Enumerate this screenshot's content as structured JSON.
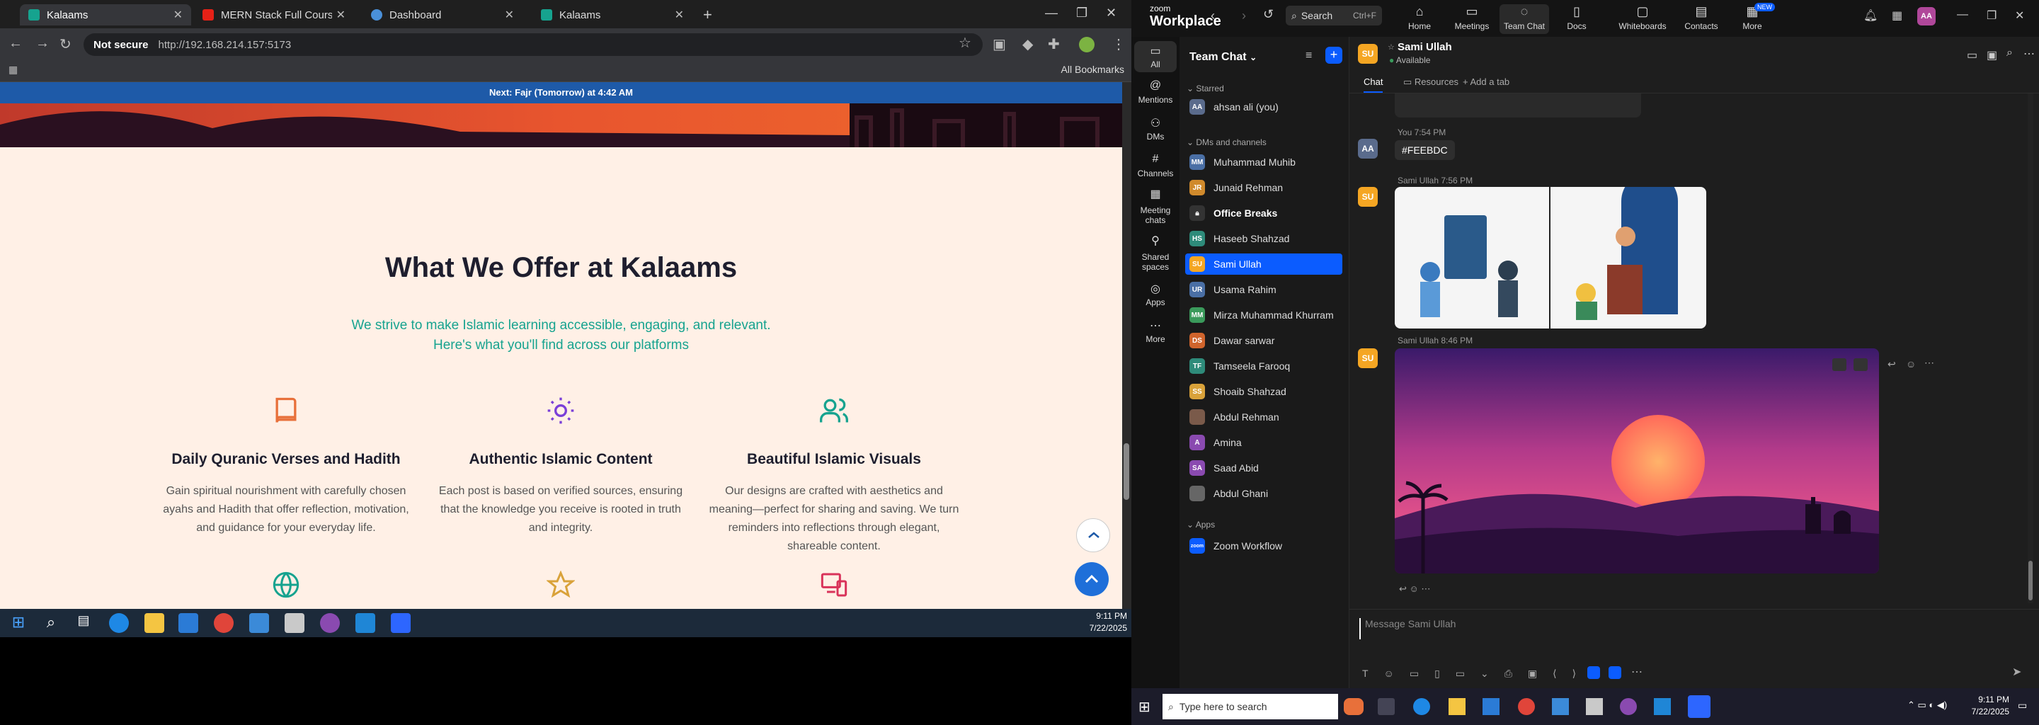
{
  "browser": {
    "tabs": [
      {
        "title": "Kalaams",
        "active": true
      },
      {
        "title": "MERN Stack Full Course - ECom",
        "active": false
      },
      {
        "title": "Dashboard",
        "active": false
      },
      {
        "title": "Kalaams",
        "active": false
      }
    ],
    "not_secure_label": "Not secure",
    "url": "http://192.168.214.157:5173",
    "all_bookmarks": "All Bookmarks"
  },
  "page": {
    "notice_prefix": "Next: ",
    "notice_prayer": "Fajr (Tomorrow)",
    "notice_suffix": " at 4:42 AM",
    "title": "What We Offer at Kalaams",
    "subtitle_line1": "We strive to make Islamic learning accessible, engaging, and relevant.",
    "subtitle_line2": "Here's what you'll find across our platforms",
    "features": [
      {
        "icon": "book-icon",
        "title": "Daily Quranic Verses and Hadith",
        "text": "Gain spiritual nourishment with carefully chosen ayahs and Hadith that offer reflection, motivation, and guidance for your everyday life."
      },
      {
        "icon": "sun-icon",
        "title": "Authentic Islamic Content",
        "text": "Each post is based on verified sources, ensuring that the knowledge you receive is rooted in truth and integrity."
      },
      {
        "icon": "users-icon",
        "title": "Beautiful Islamic Visuals",
        "text": "Our designs are crafted with aesthetics and meaning—perfect for sharing and saving. We turn reminders into reflections through elegant, shareable content."
      }
    ],
    "next_icons": [
      "globe-icon",
      "star-icon",
      "devices-icon"
    ],
    "accent": "#16a38f",
    "icon_color": "#e8703a"
  },
  "taskbar_left": {
    "time": "9:11 PM",
    "date": "7/22/2025"
  },
  "zoom": {
    "brand_top": "zoom",
    "brand": "Workplace",
    "search_label": "Search",
    "search_shortcut": "Ctrl+F",
    "nav": [
      {
        "label": "Home",
        "icon": "home-icon"
      },
      {
        "label": "Meetings",
        "icon": "video-icon"
      },
      {
        "label": "Team Chat",
        "icon": "chat-icon"
      },
      {
        "label": "Docs",
        "icon": "doc-icon"
      },
      {
        "label": "Whiteboards",
        "icon": "whiteboard-icon"
      },
      {
        "label": "Contacts",
        "icon": "contacts-icon"
      },
      {
        "label": "More",
        "icon": "more-icon"
      }
    ],
    "new_badge": "NEW",
    "user_initials": "AA",
    "rail": [
      "All",
      "Mentions",
      "DMs",
      "Channels",
      "Meeting chats",
      "Shared spaces",
      "Apps",
      "More"
    ],
    "team_chat_title": "Team Chat",
    "starred_label": "Starred",
    "starred": [
      {
        "initials": "AA",
        "name": "ahsan ali (you)",
        "color": "#5a6b8c"
      }
    ],
    "dms_label": "DMs and channels",
    "dms": [
      {
        "initials": "MM",
        "name": "Muhammad Muhib",
        "color": "#4a6fa5"
      },
      {
        "initials": "JR",
        "name": "Junaid Rehman",
        "color": "#d08a2c"
      },
      {
        "initials": "",
        "name": "Office Breaks",
        "color": "#333333",
        "bold": true
      },
      {
        "initials": "HS",
        "name": "Haseeb Shahzad",
        "color": "#2e8b7a"
      },
      {
        "initials": "SU",
        "name": "Sami Ullah",
        "color": "#f5a623",
        "selected": true
      },
      {
        "initials": "UR",
        "name": "Usama Rahim",
        "color": "#4a6fa5"
      },
      {
        "initials": "MM",
        "name": "Mirza Muhammad Khurram",
        "color": "#3a9a5b"
      },
      {
        "initials": "DS",
        "name": "Dawar sarwar",
        "color": "#d0642c"
      },
      {
        "initials": "TF",
        "name": "Tamseela Farooq",
        "color": "#2e8b7a"
      },
      {
        "initials": "SS",
        "name": "Shoaib Shahzad",
        "color": "#d9a23a"
      },
      {
        "initials": "",
        "name": "Abdul Rehman",
        "color": "#7a5a4a"
      },
      {
        "initials": "A",
        "name": "Amina",
        "color": "#8a4ab0"
      },
      {
        "initials": "SA",
        "name": "Saad Abid",
        "color": "#8a4ab0"
      },
      {
        "initials": "",
        "name": "Abdul Ghani",
        "color": "#666666"
      }
    ],
    "apps_label": "Apps",
    "apps": [
      {
        "initials": "zoom",
        "name": "Zoom Workflow",
        "color": "#0b5cff"
      }
    ],
    "chat_user": "Sami Ullah",
    "chat_status": "Available",
    "chat_tabs": [
      "Chat",
      "Resources",
      "Add a tab"
    ],
    "messages": [
      {
        "sender": "You",
        "time": "7:54 PM",
        "text": "#FEEBDC"
      },
      {
        "sender": "Sami Ullah",
        "time": "7:56 PM"
      },
      {
        "sender": "Sami Ullah",
        "time": "8:46 PM"
      }
    ],
    "compose_placeholder": "Message Sami Ullah",
    "taskbar_search": "Type here to search",
    "time": "9:11 PM",
    "date": "7/22/2025"
  }
}
